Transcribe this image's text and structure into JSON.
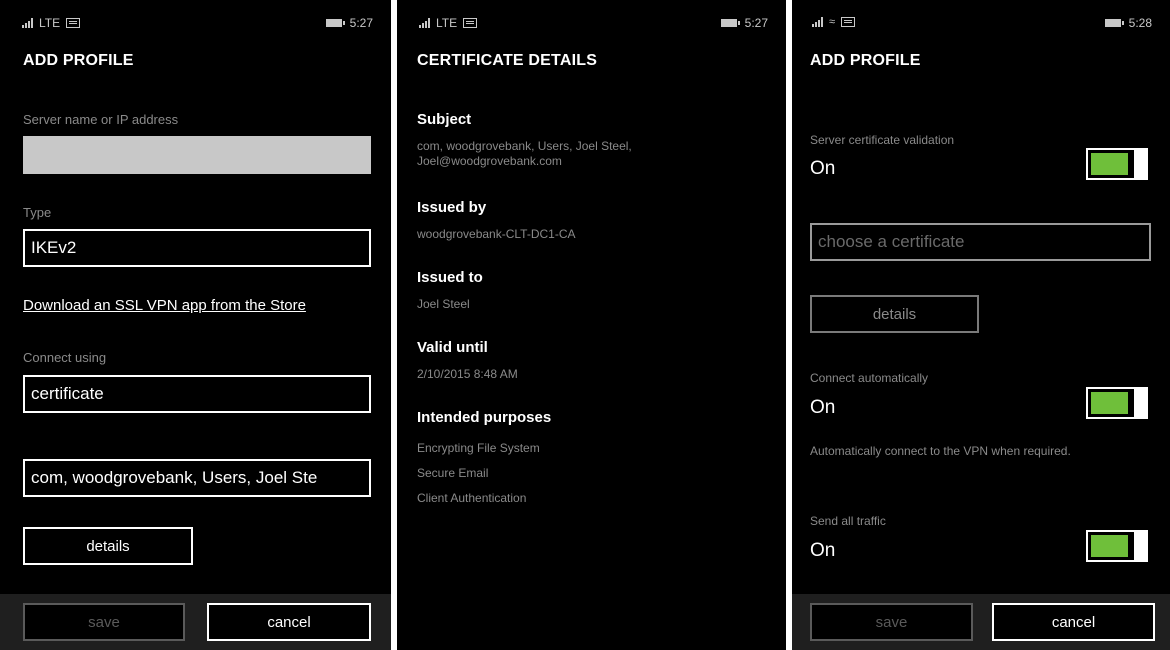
{
  "screen1": {
    "status": {
      "network": "LTE",
      "time": "5:27"
    },
    "title": "ADD PROFILE",
    "server_label": "Server name or IP address",
    "server_value": "",
    "type_label": "Type",
    "type_value": "IKEv2",
    "store_link": "Download an SSL VPN app from the Store",
    "connect_label": "Connect using",
    "connect_value": "certificate",
    "certificate_value": "com, woodgrovebank, Users, Joel Ste",
    "details_label": "details",
    "save_label": "save",
    "cancel_label": "cancel"
  },
  "screen2": {
    "status": {
      "network": "LTE",
      "time": "5:27"
    },
    "title": "CERTIFICATE DETAILS",
    "subject_label": "Subject",
    "subject_line1": "com, woodgrovebank, Users, Joel Steel,",
    "subject_line2": "Joel@woodgrovebank.com",
    "issued_by_label": "Issued by",
    "issued_by_value": "woodgrovebank-CLT-DC1-CA",
    "issued_to_label": "Issued to",
    "issued_to_value": "Joel Steel",
    "valid_until_label": "Valid until",
    "valid_until_value": "2/10/2015 8:48 AM",
    "purposes_label": "Intended purposes",
    "purposes": [
      "Encrypting File System",
      "Secure Email",
      "Client Authentication"
    ]
  },
  "screen3": {
    "status": {
      "time": "5:28"
    },
    "title": "ADD PROFILE",
    "server_cert_label": "Server certificate validation",
    "server_cert_value": "On",
    "cert_placeholder": "choose a certificate",
    "details_label": "details",
    "auto_connect_label": "Connect automatically",
    "auto_connect_value": "On",
    "auto_connect_desc": "Automatically connect to the VPN when required.",
    "send_traffic_label": "Send all traffic",
    "send_traffic_value": "On",
    "save_label": "save",
    "cancel_label": "cancel",
    "toggle_color": "#6fbf3a"
  }
}
